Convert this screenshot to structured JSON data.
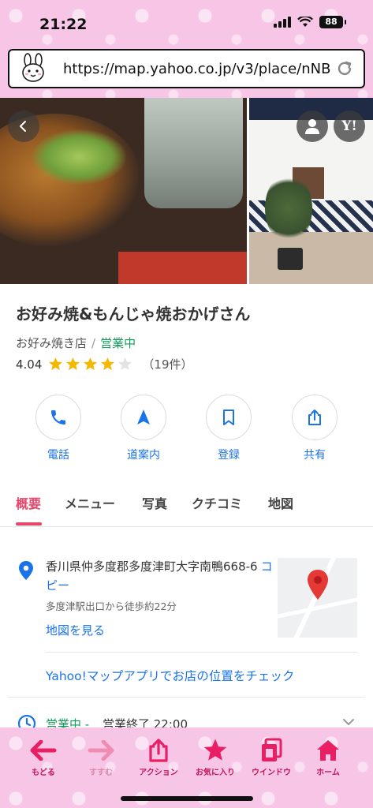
{
  "status": {
    "time": "21:22",
    "battery": "88"
  },
  "browser": {
    "url": "https://map.yahoo.co.jp/v3/place/nNB..."
  },
  "photo_overlay": {
    "yahoo_label": "Y!"
  },
  "place": {
    "name": "お好み焼&もんじゃ焼おかげさん",
    "category": "お好み焼き店",
    "separator": "/",
    "status": "営業中",
    "rating": "4.04",
    "stars_value": 4,
    "stars_max": 5,
    "review_count": "（19件）"
  },
  "actions": [
    {
      "label": "電話",
      "icon": "phone-icon"
    },
    {
      "label": "道案内",
      "icon": "navigation-arrow-icon"
    },
    {
      "label": "登録",
      "icon": "bookmark-icon"
    },
    {
      "label": "共有",
      "icon": "share-icon"
    }
  ],
  "tabs": [
    {
      "label": "概要",
      "active": true
    },
    {
      "label": "メニュー",
      "active": false
    },
    {
      "label": "写真",
      "active": false
    },
    {
      "label": "クチコミ",
      "active": false
    },
    {
      "label": "地図",
      "active": false
    }
  ],
  "address": {
    "line": "香川県仲多度郡多度津町大字南鴨668-6",
    "copy_label": "コピー",
    "station": "多度津駅出口から徒歩約22分",
    "map_link": "地図を見る"
  },
  "app_link": "Yahoo!マップアプリでお店の位置をチェック",
  "hours": {
    "status": "営業中",
    "separator": "-",
    "text": "営業終了 22:00"
  },
  "toolbar": [
    {
      "label": "もどる",
      "icon": "back-arrow-icon",
      "enabled": true
    },
    {
      "label": "すすむ",
      "icon": "forward-arrow-icon",
      "enabled": false
    },
    {
      "label": "アクション",
      "icon": "share-icon",
      "enabled": true
    },
    {
      "label": "お気に入り",
      "icon": "star-icon",
      "enabled": true
    },
    {
      "label": "ウインドウ",
      "icon": "window-icon",
      "enabled": true
    },
    {
      "label": "ホーム",
      "icon": "home-icon",
      "enabled": true
    }
  ],
  "colors": {
    "accent": "#e8456a",
    "link": "#1a73e8",
    "open": "#0f9d58",
    "star": "#f5b800",
    "toolbar_pink": "#f7c6e6",
    "toolbar_icon": "#e91e63"
  }
}
